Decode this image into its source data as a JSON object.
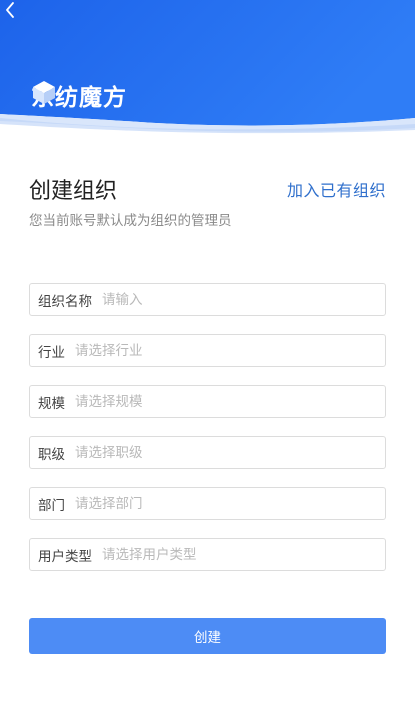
{
  "header": {
    "brand_name": "东纺魔方"
  },
  "title": "创建组织",
  "join_link": "加入已有组织",
  "subtitle": "您当前账号默认成为组织的管理员",
  "form": {
    "fields": [
      {
        "label": "组织名称",
        "value": "",
        "placeholder": "请输入"
      },
      {
        "label": "行业",
        "value": "",
        "placeholder": "请选择行业"
      },
      {
        "label": "规模",
        "value": "",
        "placeholder": "请选择规模"
      },
      {
        "label": "职级",
        "value": "",
        "placeholder": "请选择职级"
      },
      {
        "label": "部门",
        "value": "",
        "placeholder": "请选择部门"
      },
      {
        "label": "用户类型",
        "value": "",
        "placeholder": "请选择用户类型"
      }
    ]
  },
  "submit_label": "创建",
  "colors": {
    "header_blue": "#1f6cf2",
    "link_blue": "#2f6fcc",
    "button_blue": "#4d8cf5"
  },
  "icons": {
    "back": "chevron-left-icon",
    "logo": "cube-logo-icon"
  }
}
